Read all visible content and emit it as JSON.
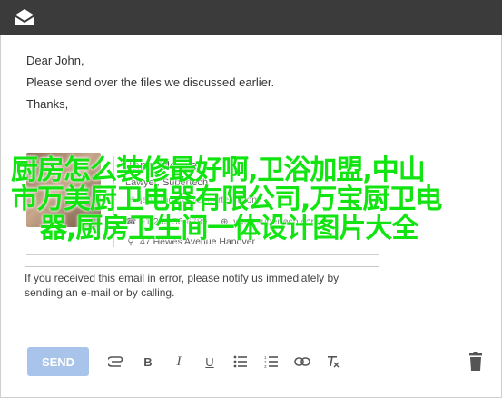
{
  "compose": {
    "greeting": "Dear John,",
    "body": "Please send over the files we discussed earlier.",
    "closing": "Thanks,"
  },
  "signature": {
    "name": "Jane Moore",
    "title": "Lawyer, Supertech",
    "email": "jane.moore@supertech.com",
    "phone": "+1 234-56-6789",
    "website": "www.supertech.com",
    "address": "47 Hewes Avenue Hanover"
  },
  "disclaimer": "If you received this email in error, please notify us immediately by sending an e-mail or by calling.",
  "overlay": {
    "line1": "厨房怎么装修最好啊,卫浴加盟,中山",
    "line2": "市万美厨卫电器有限公司,万宝厨卫电",
    "line3": "器,厨房卫生间一体设计图片大全"
  },
  "toolbar": {
    "send_label": "SEND",
    "icons": [
      "attach-icon",
      "bold-icon",
      "italic-icon",
      "underline-icon",
      "bulleted-list-icon",
      "numbered-list-icon",
      "link-icon",
      "clear-format-icon",
      "trash-icon"
    ]
  },
  "colors": {
    "topbar": "#3b3b3b",
    "send_button": "#a8c4ea",
    "overlay_text": "#12e412"
  }
}
